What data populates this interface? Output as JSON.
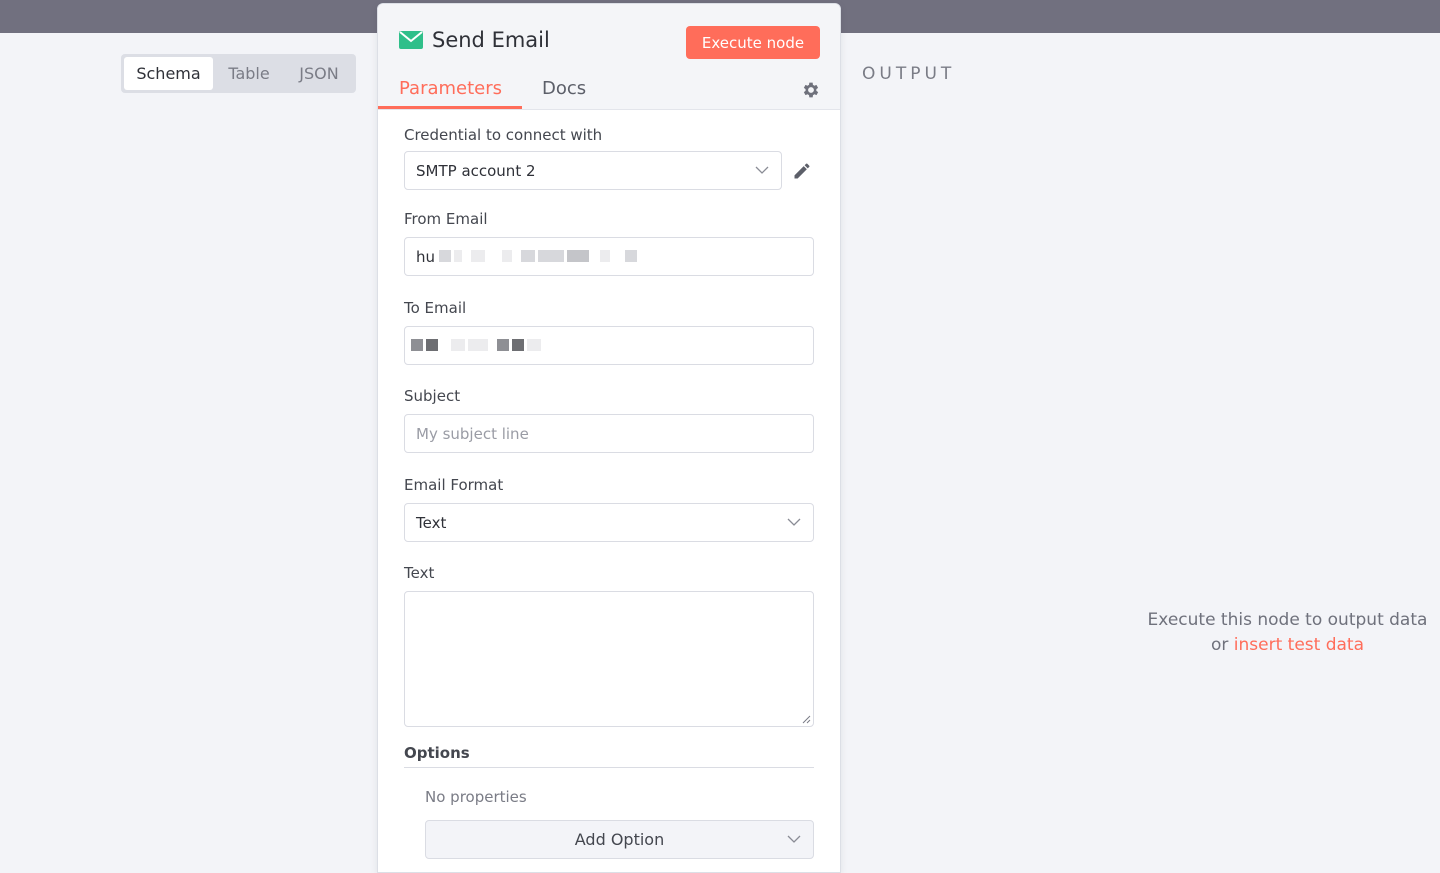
{
  "input_pane": {
    "views": [
      "Schema",
      "Table",
      "JSON"
    ],
    "active_view": "Schema"
  },
  "node": {
    "title": "Send Email",
    "icon": "envelope-icon",
    "execute_label": "Execute node",
    "tabs": [
      "Parameters",
      "Docs"
    ],
    "active_tab": "Parameters"
  },
  "params": {
    "credential_label": "Credential to connect with",
    "credential_value": "SMTP account 2",
    "from_label": "From Email",
    "from_value_visible": "hu",
    "to_label": "To Email",
    "subject_label": "Subject",
    "subject_placeholder": "My subject line",
    "format_label": "Email Format",
    "format_value": "Text",
    "text_label": "Text",
    "options_label": "Options",
    "no_properties": "No properties",
    "add_option_label": "Add Option"
  },
  "output": {
    "label": "OUTPUT",
    "message": "Execute this node to output data",
    "or": "or",
    "link": "insert test data"
  },
  "colors": {
    "accent": "#ff6d5a",
    "envelope": "#2fbf8a",
    "topbar": "#71707f"
  }
}
